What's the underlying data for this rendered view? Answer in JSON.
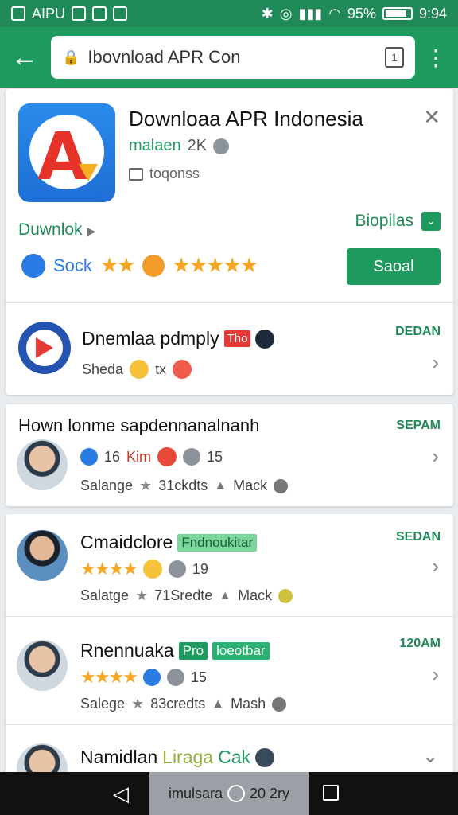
{
  "statusbar": {
    "carrier": "AIPU",
    "battery": "95%",
    "time": "9:94"
  },
  "appbar": {
    "url": "Ibovnload APR Con",
    "tab_count": "1"
  },
  "card1": {
    "title": "Downloaa APR Indonesia",
    "developer": "malaen",
    "rating_count": "2K",
    "category": "toqonss",
    "download_link": "Duwnlok",
    "bioplas_label": "Biopilas",
    "sock_label": "Sock",
    "send_button": "Saoal",
    "row2": {
      "name": "Dnemlaa pdmply",
      "badge": "Tho",
      "sub": "Sheda",
      "sub_extra": "tx",
      "time": "DEDAN"
    }
  },
  "card2": {
    "title": "Hown lonme sapdennanalnanh",
    "time": "SEPAM",
    "count": "16",
    "name": "Kim",
    "reply": "15",
    "sub_a": "Salange",
    "sub_b": "31ckdts",
    "sub_c": "Mack"
  },
  "card3": {
    "row1": {
      "name": "Cmaidclore",
      "badge": "Fndnoukitar",
      "reply": "19",
      "sub_a": "Salatge",
      "sub_b": "71Sredte",
      "sub_c": "Mack",
      "time": "SEDAN"
    },
    "row2": {
      "name": "Rnennuaka",
      "badge1": "Pro",
      "badge2": "loeotbar",
      "reply": "15",
      "sub_a": "Salege",
      "sub_b": "83credts",
      "sub_c": "Mash",
      "time": "120AM"
    },
    "row3": {
      "name_a": "Namidlan",
      "name_b": "Liraga",
      "name_c": "Cak"
    }
  },
  "navbar": {
    "mid_text_a": "imulsara",
    "mid_text_b": "20 2ry"
  }
}
